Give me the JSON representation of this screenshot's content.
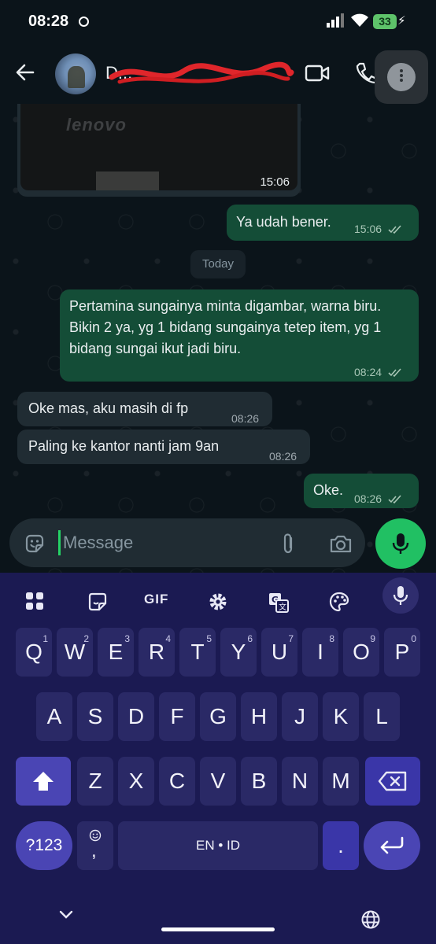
{
  "status_bar": {
    "time": "08:28",
    "battery": "33"
  },
  "header": {
    "contact_name": "D...",
    "back": "back",
    "video": "video-call",
    "call": "voice-call",
    "menu": "more-options"
  },
  "image_message": {
    "logo": "lenovo",
    "time": "15:06"
  },
  "messages": [
    {
      "dir": "out",
      "text": "Ya udah bener.",
      "time": "15:06"
    },
    {
      "dir": "out",
      "text": "Pertamina sungainya minta digambar, warna biru. Bikin 2 ya, yg 1 bidang sungainya tetep item, yg 1 bidang sungai ikut jadi biru.",
      "time": "08:24"
    },
    {
      "dir": "in",
      "text": "Oke mas, aku masih di fp",
      "time": "08:26"
    },
    {
      "dir": "in",
      "text": "Paling ke kantor nanti jam 9an",
      "time": "08:26"
    },
    {
      "dir": "out",
      "text": "Oke.",
      "time": "08:26"
    }
  ],
  "day_divider": "Today",
  "composer": {
    "placeholder": "Message"
  },
  "keyboard": {
    "toolbar_gif": "GIF",
    "row1": [
      {
        "label": "Q",
        "hint": "1"
      },
      {
        "label": "W",
        "hint": "2"
      },
      {
        "label": "E",
        "hint": "3"
      },
      {
        "label": "R",
        "hint": "4"
      },
      {
        "label": "T",
        "hint": "5"
      },
      {
        "label": "Y",
        "hint": "6"
      },
      {
        "label": "U",
        "hint": "7"
      },
      {
        "label": "I",
        "hint": "8"
      },
      {
        "label": "O",
        "hint": "9"
      },
      {
        "label": "P",
        "hint": "0"
      }
    ],
    "row2": [
      "A",
      "S",
      "D",
      "F",
      "G",
      "H",
      "J",
      "K",
      "L"
    ],
    "row3": [
      "Z",
      "X",
      "C",
      "V",
      "B",
      "N",
      "M"
    ],
    "symbols": "?123",
    "emoji_comma": ",",
    "space": "EN • ID",
    "period": "."
  },
  "colors": {
    "outgoing": "#144d37",
    "incoming": "#202c33",
    "accent": "#21c063",
    "keyboard": "#1b1a52"
  }
}
